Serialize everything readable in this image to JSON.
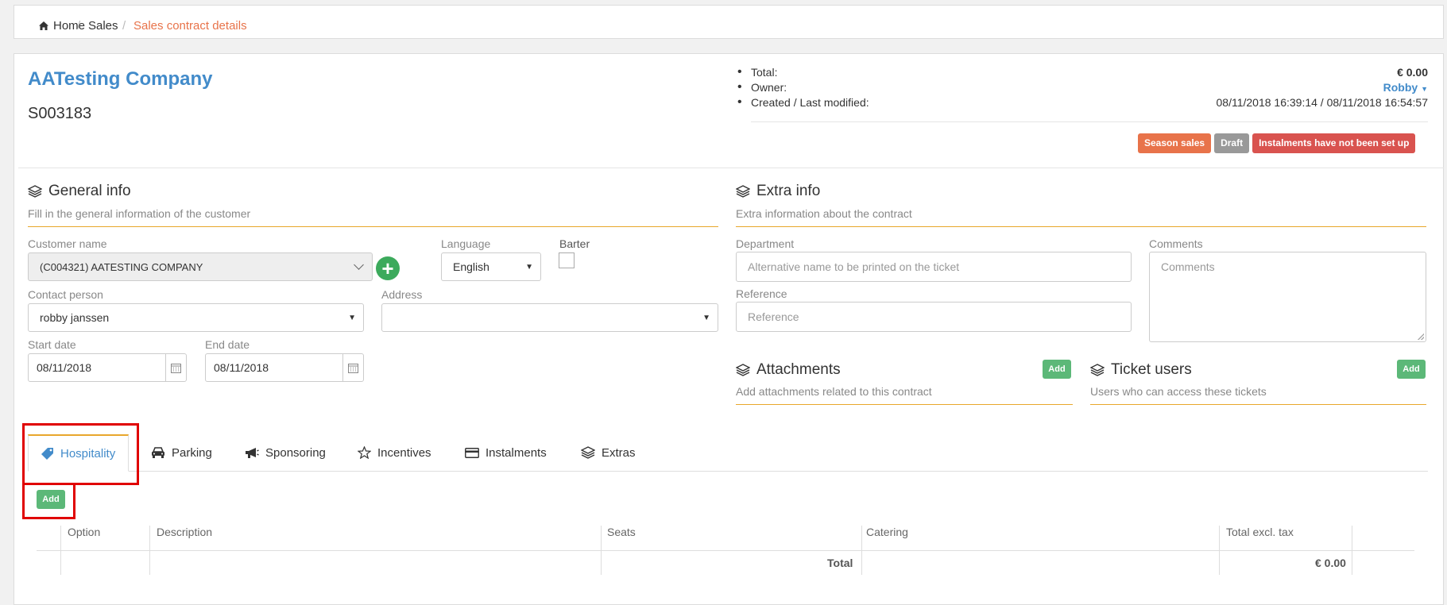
{
  "breadcrumb": {
    "home": "Home",
    "sales": "Sales",
    "current": "Sales contract details",
    "separator": "/"
  },
  "header": {
    "company": "AATesting Company",
    "contract_number": "S003183"
  },
  "info": {
    "total_label": "Total:",
    "total_value": "€ 0.00",
    "owner_label": "Owner:",
    "owner_value": "Robby",
    "created_label": "Created / Last modified:",
    "created_value": "08/11/2018 16:39:14 / 08/11/2018 16:54:57"
  },
  "badges": {
    "season": "Season sales",
    "draft": "Draft",
    "instalments": "Instalments have not been set up"
  },
  "general": {
    "title": "General info",
    "subtitle": "Fill in the general information of the customer",
    "customer_label": "Customer name",
    "customer_value": "(C004321) AATESTING COMPANY",
    "language_label": "Language",
    "language_value": "English",
    "barter_label": "Barter",
    "contact_label": "Contact person",
    "contact_value": "robby janssen",
    "address_label": "Address",
    "start_label": "Start date",
    "start_value": "08/11/2018",
    "end_label": "End date",
    "end_value": "08/11/2018"
  },
  "extra": {
    "title": "Extra info",
    "subtitle": "Extra information about the contract",
    "department_label": "Department",
    "department_placeholder": "Alternative name to be printed on the ticket",
    "reference_label": "Reference",
    "reference_placeholder": "Reference",
    "comments_label": "Comments",
    "comments_placeholder": "Comments"
  },
  "attachments": {
    "title": "Attachments",
    "subtitle": "Add attachments related to this contract",
    "add": "Add"
  },
  "ticket_users": {
    "title": "Ticket users",
    "subtitle": "Users who can access these tickets",
    "add": "Add"
  },
  "tabs": {
    "hospitality": "Hospitality",
    "parking": "Parking",
    "sponsoring": "Sponsoring",
    "incentives": "Incentives",
    "instalments": "Instalments",
    "extras": "Extras"
  },
  "table": {
    "add": "Add",
    "columns": [
      "Option",
      "Description",
      "Seats",
      "Catering",
      "Total excl. tax"
    ],
    "total_label": "Total",
    "total_value": "€ 0.00"
  },
  "colors": {
    "link": "#428bca",
    "accent": "#e8734a",
    "section_line": "#e8a72c",
    "add_button": "#5cb878",
    "highlight": "#e00000"
  }
}
